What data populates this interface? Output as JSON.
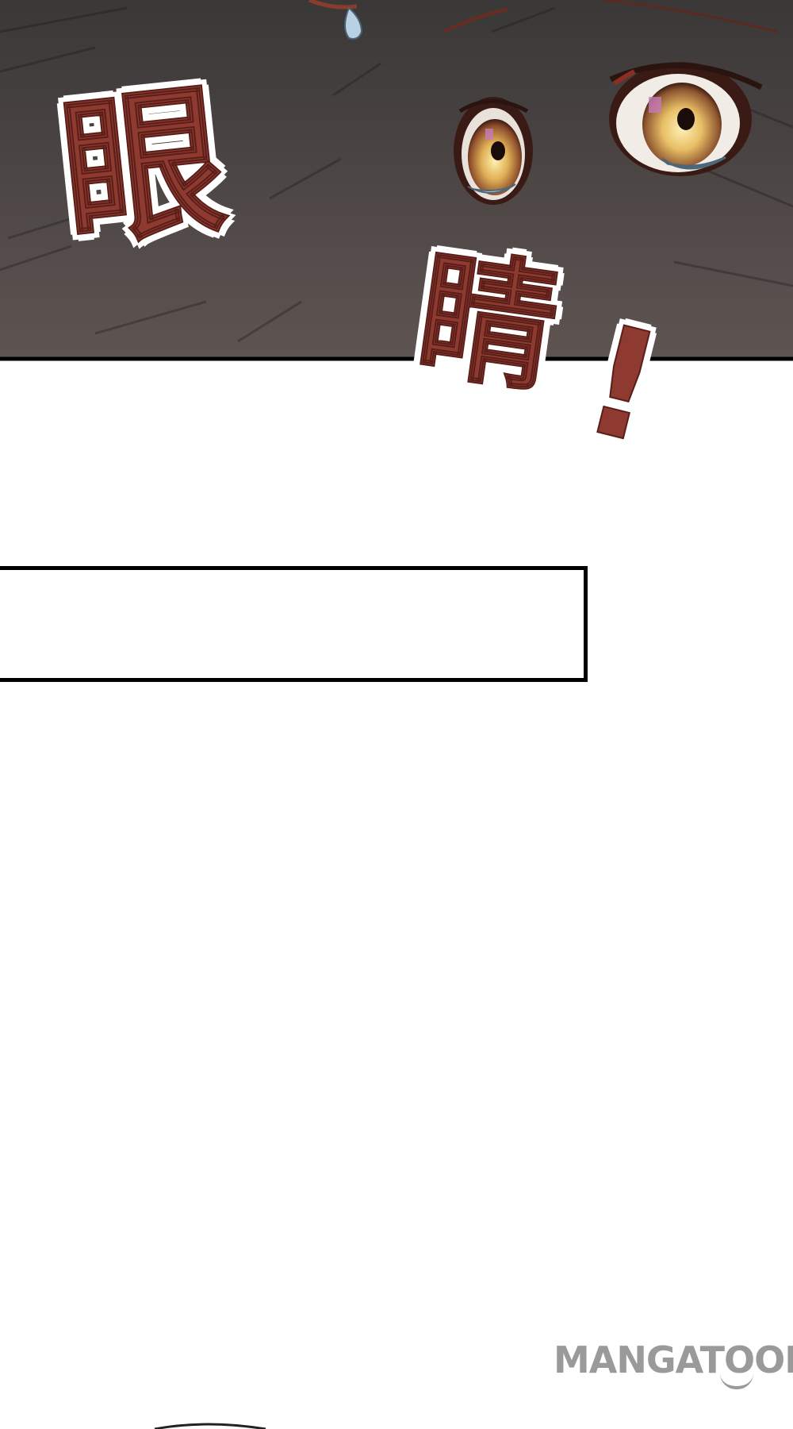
{
  "panel": {
    "sfx_char_1": "眼",
    "sfx_char_2": "睛",
    "sfx_char_3": "!",
    "description": ""
  },
  "caption_box": {
    "text": ""
  },
  "watermark": {
    "text": "MANGATOON"
  },
  "colors": {
    "panel_background": "#4a4644",
    "sfx_fill": "#8e3a31",
    "sfx_outline": "#ffffff",
    "iris": "#d9a64a",
    "border": "#000000",
    "watermark": "#9a9a9a"
  }
}
